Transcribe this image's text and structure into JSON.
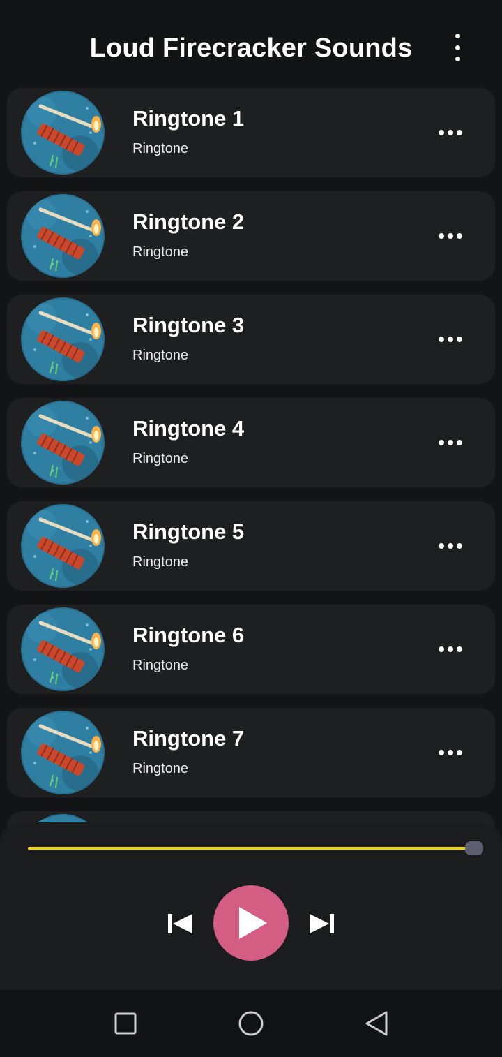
{
  "header": {
    "title": "Loud Firecracker Sounds",
    "menu_icon": "more-vert-icon"
  },
  "ringtones": [
    {
      "title": "Ringtone 1",
      "subtitle": "Ringtone"
    },
    {
      "title": "Ringtone 2",
      "subtitle": "Ringtone"
    },
    {
      "title": "Ringtone 3",
      "subtitle": "Ringtone"
    },
    {
      "title": "Ringtone 4",
      "subtitle": "Ringtone"
    },
    {
      "title": "Ringtone 5",
      "subtitle": "Ringtone"
    },
    {
      "title": "Ringtone 6",
      "subtitle": "Ringtone"
    },
    {
      "title": "Ringtone 7",
      "subtitle": "Ringtone"
    }
  ],
  "row_menu_icon": "more-horiz-icon",
  "player": {
    "progress": 1.0,
    "progress_color": "#f2d20b",
    "play_button_color": "#d45d83",
    "icons": [
      "skip-previous-icon",
      "play-icon",
      "skip-next-icon"
    ]
  },
  "nav_bar": {
    "icons": [
      "recents-square-icon",
      "home-circle-icon",
      "back-triangle-icon"
    ]
  }
}
